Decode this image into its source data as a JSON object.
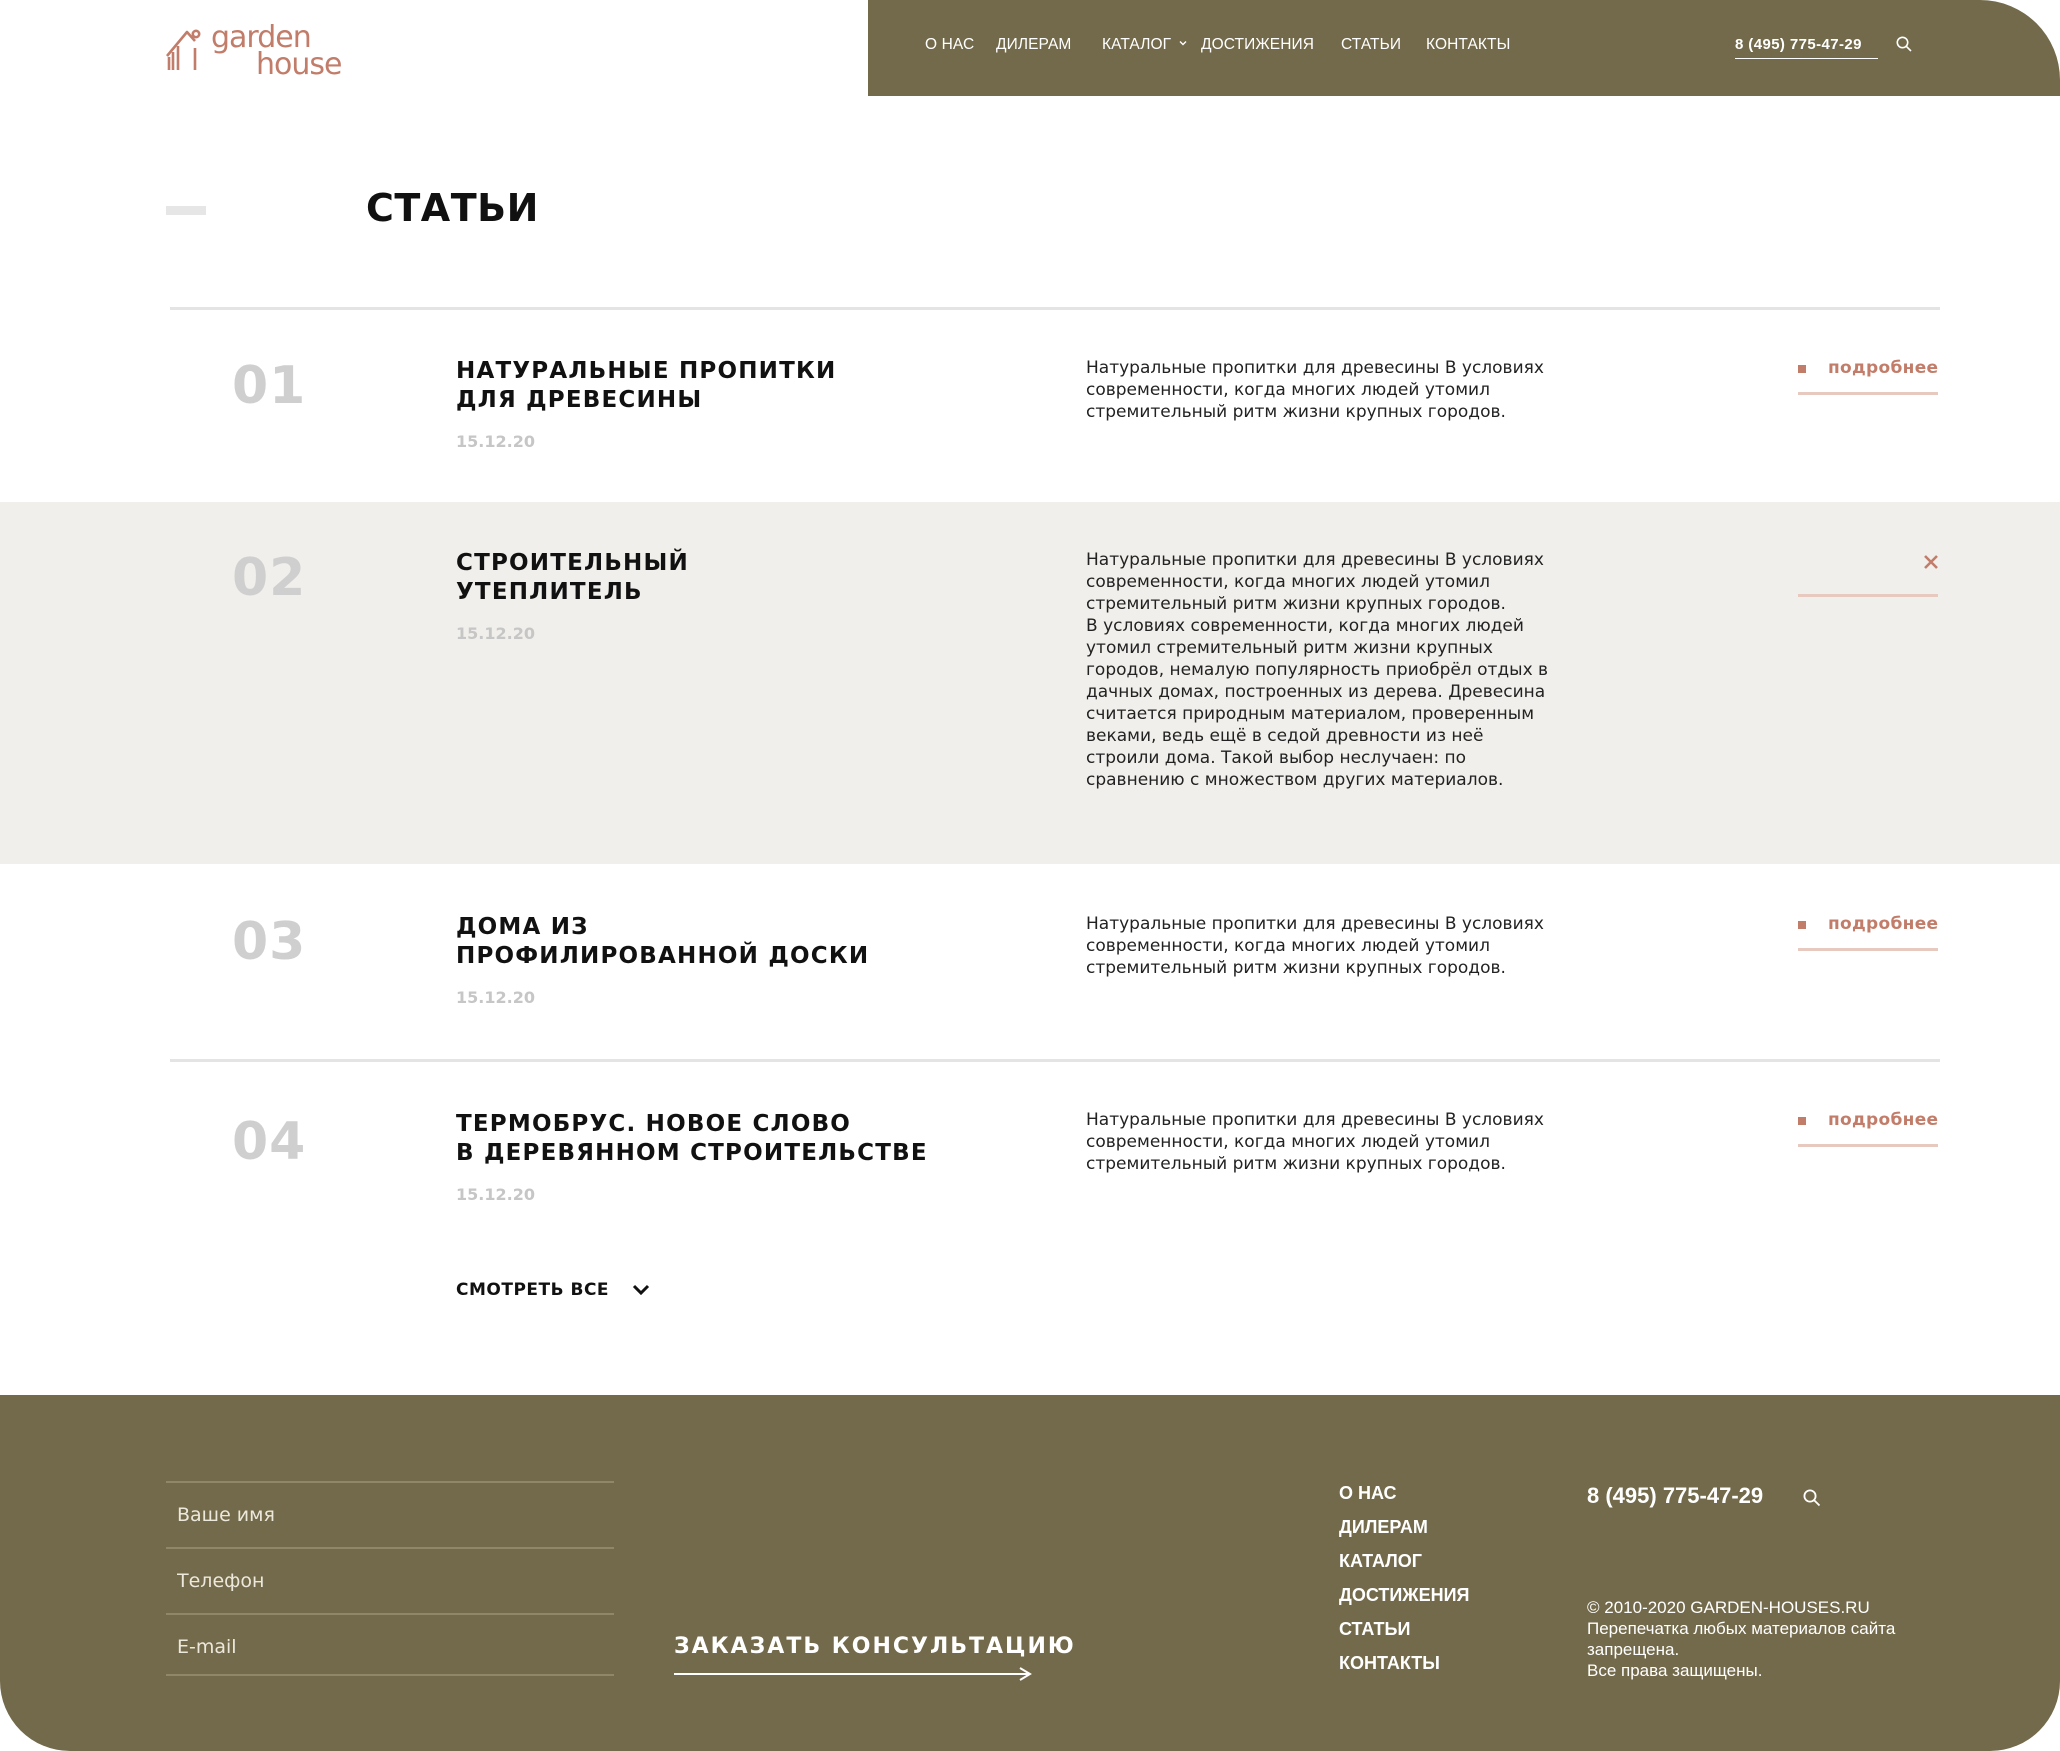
{
  "brand": {
    "line1": "garden",
    "line2": "house",
    "accent": "#c27d6a",
    "olive": "#736a4b"
  },
  "nav": {
    "items": [
      "О НАС",
      "ДИЛЕРАМ",
      "КАТАЛОГ",
      "ДОСТИЖЕНИЯ",
      "СТАТЬИ",
      "КОНТАКТЫ"
    ],
    "phone": "8 (495) 775-47-29"
  },
  "page": {
    "title": "СТАТЬИ"
  },
  "articles": [
    {
      "num": "01",
      "title": [
        "НАТУРАЛЬНЫЕ ПРОПИТКИ",
        "ДЛЯ ДРЕВЕСИНЫ"
      ],
      "date": "15.12.20",
      "desc": [
        "Натуральные пропитки для древесины В условиях",
        "современности, когда многих людей утомил",
        "стремительный ритм жизни крупных городов."
      ],
      "more": "подробнее",
      "expanded": false
    },
    {
      "num": "02",
      "title": [
        "СТРОИТЕЛЬНЫЙ",
        "УТЕПЛИТЕЛЬ"
      ],
      "date": "15.12.20",
      "desc": [
        "Натуральные пропитки для древесины В условиях",
        "современности, когда многих людей утомил",
        "стремительный ритм жизни крупных городов.",
        "В условиях современности, когда многих людей",
        "утомил стремительный ритм жизни крупных",
        "городов, немалую популярность приобрёл отдых в",
        "дачных домах, построенных из дерева. Древесина",
        "считается природным материалом, проверенным",
        "веками, ведь ещё в седой древности из неё",
        "строили дома. Такой выбор неслучаен: по",
        "сравнению с множеством других материалов."
      ],
      "more": "",
      "expanded": true
    },
    {
      "num": "03",
      "title": [
        "ДОМА ИЗ",
        "ПРОФИЛИРОВАННОЙ ДОСКИ"
      ],
      "date": "15.12.20",
      "desc": [
        "Натуральные пропитки для древесины В условиях",
        "современности, когда многих людей утомил",
        "стремительный ритм жизни крупных городов."
      ],
      "more": "подробнее",
      "expanded": false
    },
    {
      "num": "04",
      "title": [
        "ТЕРМОБРУС. НОВОЕ СЛОВО",
        "В ДЕРЕВЯННОМ СТРОИТЕЛЬСТВЕ"
      ],
      "date": "15.12.20",
      "desc": [
        "Натуральные пропитки для древесины В условиях",
        "современности, когда многих людей утомил",
        "стремительный ритм жизни крупных городов."
      ],
      "more": "подробнее",
      "expanded": false
    }
  ],
  "view_all": "СМОТРЕТЬ ВСЕ",
  "footer": {
    "fields": [
      "Ваше имя",
      "Телефон",
      "E-mail"
    ],
    "cta": "ЗАКАЗАТЬ КОНСУЛЬТАЦИЮ",
    "nav": [
      "О НАС",
      "ДИЛЕРАМ",
      "КАТАЛОГ",
      "ДОСТИЖЕНИЯ",
      "СТАТЬИ",
      "КОНТАКТЫ"
    ],
    "phone": "8 (495) 775-47-29",
    "copyright": [
      "© 2010-2020 GARDEN-HOUSES.RU",
      "Перепечатка любых материалов сайта",
      "запрещена.",
      "Все права защищены."
    ]
  }
}
